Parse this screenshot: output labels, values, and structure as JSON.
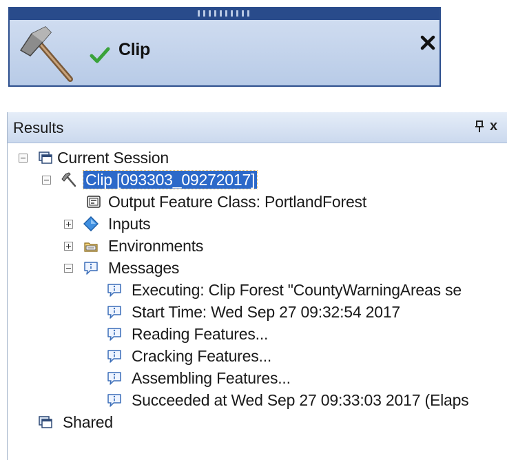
{
  "clip_dialog": {
    "title": "Clip",
    "close_label": "✕"
  },
  "results_panel": {
    "title": "Results",
    "pin_label": "pin",
    "close_label": "x"
  },
  "tree": {
    "current_session": "Current Session",
    "clip_job": "Clip [093303_09272017]",
    "output_feature_class": "Output Feature Class: PortlandForest",
    "inputs": "Inputs",
    "environments": "Environments",
    "messages": "Messages",
    "message_items": [
      "Executing: Clip Forest \"CountyWarningAreas se",
      "Start Time: Wed Sep 27 09:32:54 2017",
      "Reading Features...",
      "Cracking Features...",
      "Assembling Features...",
      "Succeeded at Wed Sep 27 09:33:03 2017 (Elaps"
    ],
    "shared": "Shared"
  },
  "colors": {
    "title_bar": "#294b8b",
    "dialog_bg": "#c6d6ee",
    "selection": "#2c69c9",
    "check_green": "#3aa23a"
  },
  "icons": {
    "tool": "hammer-icon",
    "success": "checkmark-icon",
    "session": "session-icon",
    "output": "feature-class-icon",
    "inputs": "diamond-icon",
    "environments": "folder-icon",
    "message": "info-message-icon"
  }
}
